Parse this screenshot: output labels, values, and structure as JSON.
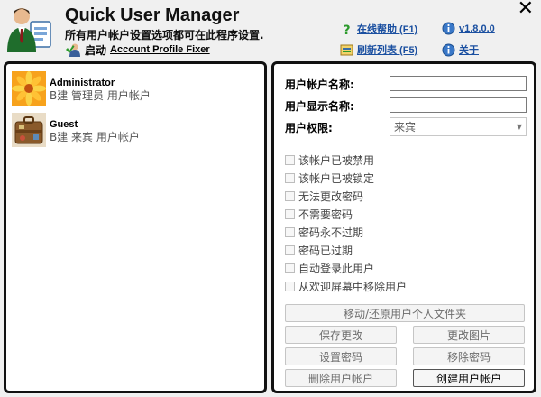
{
  "header": {
    "title": "Quick User Manager",
    "subtitle": "所有用户帐户设置选项都可在此程序设置.",
    "launch_label": "启动",
    "launch_link": "Account Profile Fixer",
    "close_glyph": "✕",
    "links": {
      "help": "在线帮助 (F1)",
      "refresh": "刷新列表 (F5)",
      "version": "v1.8.0.0",
      "about": "关于"
    }
  },
  "users": [
    {
      "name": "Administrator",
      "desc": "B建 管理员 用户帐户",
      "icon": "flower-avatar-icon"
    },
    {
      "name": "Guest",
      "desc": "B建 来宾 用户帐户",
      "icon": "suitcase-avatar-icon"
    }
  ],
  "form": {
    "account_name_label": "用户帐户名称:",
    "account_name_value": "",
    "display_name_label": "用户显示名称:",
    "display_name_value": "",
    "permission_label": "用户权限:",
    "permission_value": "来宾",
    "checkboxes": [
      "该帐户已被禁用",
      "该帐户已被锁定",
      "无法更改密码",
      "不需要密码",
      "密码永不过期",
      "密码已过期",
      "自动登录此用户",
      "从欢迎屏幕中移除用户"
    ]
  },
  "buttons": {
    "move_restore": "移动/还原用户个人文件夹",
    "save": "保存更改",
    "change_picture": "更改图片",
    "set_password": "设置密码",
    "remove_password": "移除密码",
    "delete_user": "删除用户帐户",
    "create_user": "创建用户帐户"
  },
  "colors": {
    "link": "#1a4fa0",
    "panel_border": "#111111",
    "disabled_text": "#6d6d6d"
  }
}
